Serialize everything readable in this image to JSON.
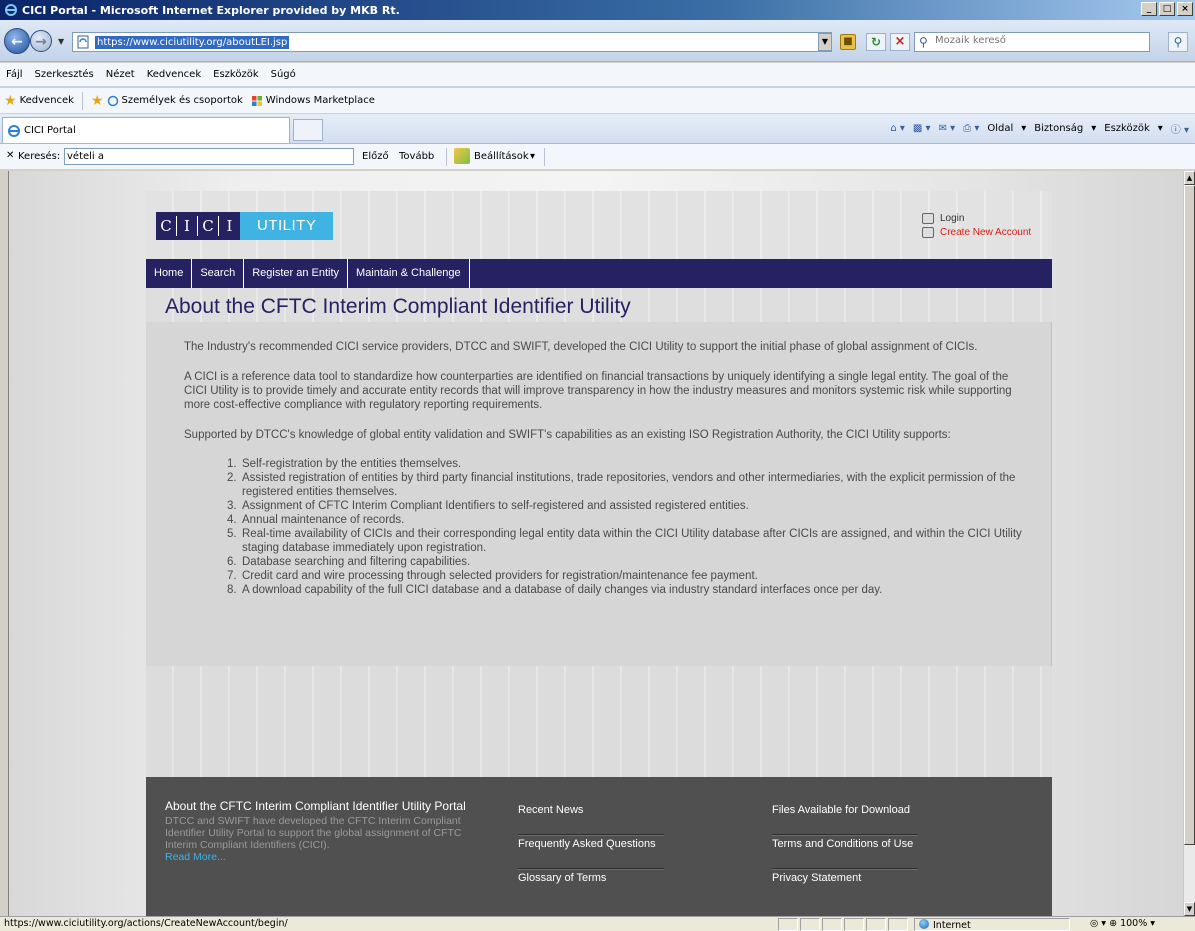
{
  "window": {
    "title": "CICI Portal - Microsoft Internet Explorer provided by MKB Rt.",
    "min": "_",
    "max": "□",
    "close": "×"
  },
  "address": {
    "url": "https://www.ciciutility.org/aboutLEI.jsp",
    "search_placeholder": "Mozaik kereső"
  },
  "menu": [
    "Fájl",
    "Szerkesztés",
    "Nézet",
    "Kedvencek",
    "Eszközök",
    "Súgó"
  ],
  "favorites": {
    "label": "Kedvencek",
    "items": [
      "Személyek és csoportok",
      "Windows Marketplace"
    ]
  },
  "tab": {
    "title": "CICI Portal"
  },
  "commandbar": {
    "page": "Oldal",
    "safety": "Biztonság",
    "tools": "Eszközök"
  },
  "find": {
    "label": "Keresés:",
    "value": "vételi a",
    "prev": "Előző",
    "next": "Tovább",
    "options": "Beállítások"
  },
  "site": {
    "logo_letters": [
      "C",
      "I",
      "C",
      "I"
    ],
    "logo_word": "UTILITY",
    "login": "Login",
    "create_account": "Create New Account",
    "nav": [
      "Home",
      "Search",
      "Register an Entity",
      "Maintain & Challenge"
    ],
    "page_title": "About the CFTC Interim Compliant Identifier Utility",
    "paragraphs": [
      "The Industry's recommended CICI service providers, DTCC and SWIFT, developed the CICI Utility to support the initial phase of global assignment of CICIs.",
      "A CICI is a reference data tool to standardize how counterparties are identified on financial transactions by uniquely identifying a single legal entity. The goal of the CICI Utility is to provide timely and accurate entity records that will improve transparency in how the industry measures and monitors systemic risk while supporting more cost-effective compliance with regulatory reporting requirements.",
      "Supported by DTCC's knowledge of global entity validation and SWIFT's capabilities as an existing ISO Registration Authority, the CICI Utility supports:"
    ],
    "list": [
      "Self-registration by the entities themselves.",
      "Assisted registration of entities by third party financial institutions, trade repositories, vendors and other intermediaries, with the explicit permission of the registered entities themselves.",
      "Assignment of CFTC Interim Compliant Identifiers to self-registered and assisted registered entities.",
      "Annual maintenance of records.",
      "Real-time availability of CICIs and their corresponding legal entity data within the CICI Utility database after CICIs are assigned, and within the CICI Utility staging database immediately upon registration.",
      "Database searching and filtering capabilities.",
      "Credit card and wire processing through selected providers for registration/maintenance fee payment.",
      "A download capability of the full CICI database and a database of daily changes via industry standard interfaces once per day."
    ],
    "footer": {
      "about_title": "About the CFTC Interim Compliant Identifier Utility Portal",
      "about_text": "DTCC and SWIFT have developed the CFTC Interim Compliant Identifier Utility Portal to support the global assignment of CFTC Interim Compliant Identifiers (CICI).",
      "read_more": "Read More...",
      "col1": [
        "Recent News",
        "Frequently Asked Questions",
        "Glossary of Terms"
      ],
      "col2": [
        "Files Available for Download",
        "Terms and Conditions of Use",
        "Privacy Statement"
      ]
    }
  },
  "status": {
    "text": "https://www.ciciutility.org/actions/CreateNewAccount/begin/",
    "zone": "Internet",
    "zoom": "100%"
  },
  "colors": {
    "navy": "#262262",
    "cyan": "#3fb3e3",
    "red": "#e41b17",
    "footer": "#505050"
  }
}
